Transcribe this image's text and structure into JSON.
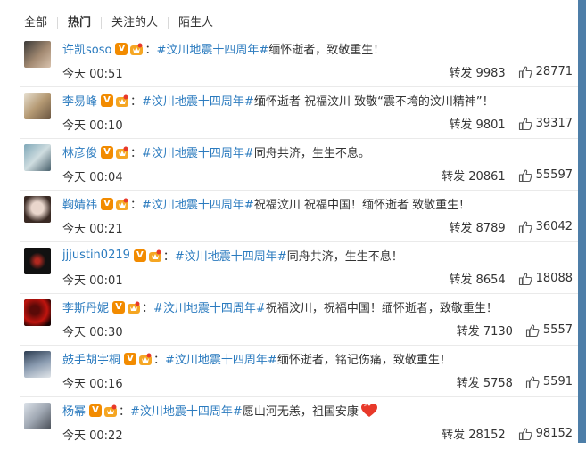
{
  "tabs": [
    {
      "label": "全部",
      "active": false
    },
    {
      "label": "热门",
      "active": true
    },
    {
      "label": "关注的人",
      "active": false
    },
    {
      "label": "陌生人",
      "active": false
    }
  ],
  "comments": [
    {
      "user": "许凯soso",
      "topic": "#汶川地震十四周年#",
      "text": "缅怀逝者，致敬重生！",
      "time": "今天 00:51",
      "repost": "转发 9983",
      "likes": "28771"
    },
    {
      "user": "李易峰",
      "topic": "#汶川地震十四周年#",
      "text": " 缅怀逝者 祝福汶川 致敬“震不垮的汶川精神”！",
      "time": "今天 00:10",
      "repost": "转发 9801",
      "likes": "39317"
    },
    {
      "user": "林彦俊",
      "topic": "#汶川地震十四周年#",
      "text": " 同舟共济，生生不息。",
      "time": "今天 00:04",
      "repost": "转发 20861",
      "likes": "55597"
    },
    {
      "user": "鞠婧祎",
      "topic": "#汶川地震十四周年#",
      "text": " 祝福汶川 祝福中国！缅怀逝者 致敬重生！",
      "time": "今天 00:21",
      "repost": "转发 8789",
      "likes": "36042"
    },
    {
      "user": "jjjustin0219",
      "topic": "#汶川地震十四周年#",
      "text": "同舟共济，生生不息！",
      "time": "今天 00:01",
      "repost": "转发 8654",
      "likes": "18088"
    },
    {
      "user": "李斯丹妮",
      "topic": "#汶川地震十四周年#",
      "text": "祝福汶川，祝福中国！缅怀逝者，致敬重生！",
      "time": "今天 00:30",
      "repost": "转发 7130",
      "likes": "5557"
    },
    {
      "user": "鼓手胡宇桐",
      "topic": "#汶川地震十四周年#",
      "text": " 缅怀逝者，铭记伤痛，致敬重生！",
      "time": "今天 00:16",
      "repost": "转发 5758",
      "likes": "5591"
    },
    {
      "user": "杨幂",
      "topic": "#汶川地震十四周年#",
      "text": " 愿山河无恙，祖国安康",
      "time": "今天 00:22",
      "repost": "转发 28152",
      "likes": "98152",
      "heart": true
    }
  ],
  "badges": {
    "verified": "V"
  },
  "colon": "：",
  "icons": {
    "verified": "verified-v-icon",
    "vip": "vip-crown-icon",
    "like": "thumbs-up-icon",
    "heart": "heart-icon"
  },
  "colors": {
    "link": "#2b7bbf",
    "badge": "#f28b00",
    "heart": "#e8392a",
    "scrollbar": "#4d7ea8"
  }
}
